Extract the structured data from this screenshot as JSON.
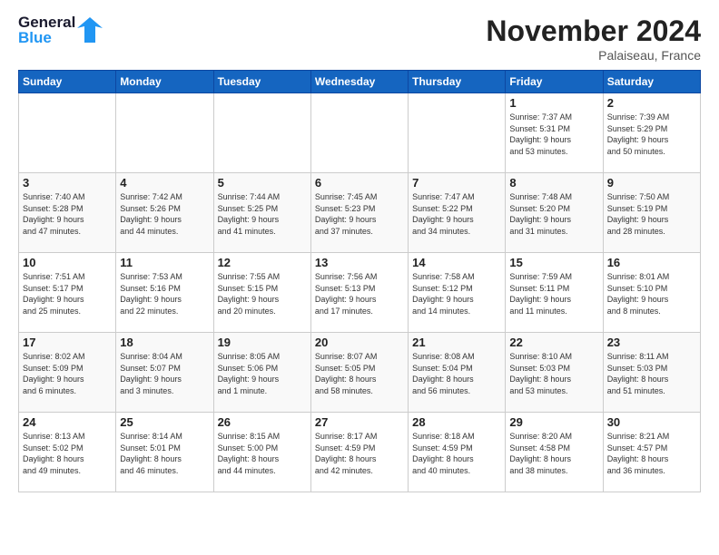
{
  "logo": {
    "line1": "General",
    "line2": "Blue"
  },
  "header": {
    "month": "November 2024",
    "location": "Palaiseau, France"
  },
  "weekdays": [
    "Sunday",
    "Monday",
    "Tuesday",
    "Wednesday",
    "Thursday",
    "Friday",
    "Saturday"
  ],
  "weeks": [
    [
      {
        "day": "",
        "info": ""
      },
      {
        "day": "",
        "info": ""
      },
      {
        "day": "",
        "info": ""
      },
      {
        "day": "",
        "info": ""
      },
      {
        "day": "",
        "info": ""
      },
      {
        "day": "1",
        "info": "Sunrise: 7:37 AM\nSunset: 5:31 PM\nDaylight: 9 hours\nand 53 minutes."
      },
      {
        "day": "2",
        "info": "Sunrise: 7:39 AM\nSunset: 5:29 PM\nDaylight: 9 hours\nand 50 minutes."
      }
    ],
    [
      {
        "day": "3",
        "info": "Sunrise: 7:40 AM\nSunset: 5:28 PM\nDaylight: 9 hours\nand 47 minutes."
      },
      {
        "day": "4",
        "info": "Sunrise: 7:42 AM\nSunset: 5:26 PM\nDaylight: 9 hours\nand 44 minutes."
      },
      {
        "day": "5",
        "info": "Sunrise: 7:44 AM\nSunset: 5:25 PM\nDaylight: 9 hours\nand 41 minutes."
      },
      {
        "day": "6",
        "info": "Sunrise: 7:45 AM\nSunset: 5:23 PM\nDaylight: 9 hours\nand 37 minutes."
      },
      {
        "day": "7",
        "info": "Sunrise: 7:47 AM\nSunset: 5:22 PM\nDaylight: 9 hours\nand 34 minutes."
      },
      {
        "day": "8",
        "info": "Sunrise: 7:48 AM\nSunset: 5:20 PM\nDaylight: 9 hours\nand 31 minutes."
      },
      {
        "day": "9",
        "info": "Sunrise: 7:50 AM\nSunset: 5:19 PM\nDaylight: 9 hours\nand 28 minutes."
      }
    ],
    [
      {
        "day": "10",
        "info": "Sunrise: 7:51 AM\nSunset: 5:17 PM\nDaylight: 9 hours\nand 25 minutes."
      },
      {
        "day": "11",
        "info": "Sunrise: 7:53 AM\nSunset: 5:16 PM\nDaylight: 9 hours\nand 22 minutes."
      },
      {
        "day": "12",
        "info": "Sunrise: 7:55 AM\nSunset: 5:15 PM\nDaylight: 9 hours\nand 20 minutes."
      },
      {
        "day": "13",
        "info": "Sunrise: 7:56 AM\nSunset: 5:13 PM\nDaylight: 9 hours\nand 17 minutes."
      },
      {
        "day": "14",
        "info": "Sunrise: 7:58 AM\nSunset: 5:12 PM\nDaylight: 9 hours\nand 14 minutes."
      },
      {
        "day": "15",
        "info": "Sunrise: 7:59 AM\nSunset: 5:11 PM\nDaylight: 9 hours\nand 11 minutes."
      },
      {
        "day": "16",
        "info": "Sunrise: 8:01 AM\nSunset: 5:10 PM\nDaylight: 9 hours\nand 8 minutes."
      }
    ],
    [
      {
        "day": "17",
        "info": "Sunrise: 8:02 AM\nSunset: 5:09 PM\nDaylight: 9 hours\nand 6 minutes."
      },
      {
        "day": "18",
        "info": "Sunrise: 8:04 AM\nSunset: 5:07 PM\nDaylight: 9 hours\nand 3 minutes."
      },
      {
        "day": "19",
        "info": "Sunrise: 8:05 AM\nSunset: 5:06 PM\nDaylight: 9 hours\nand 1 minute."
      },
      {
        "day": "20",
        "info": "Sunrise: 8:07 AM\nSunset: 5:05 PM\nDaylight: 8 hours\nand 58 minutes."
      },
      {
        "day": "21",
        "info": "Sunrise: 8:08 AM\nSunset: 5:04 PM\nDaylight: 8 hours\nand 56 minutes."
      },
      {
        "day": "22",
        "info": "Sunrise: 8:10 AM\nSunset: 5:03 PM\nDaylight: 8 hours\nand 53 minutes."
      },
      {
        "day": "23",
        "info": "Sunrise: 8:11 AM\nSunset: 5:03 PM\nDaylight: 8 hours\nand 51 minutes."
      }
    ],
    [
      {
        "day": "24",
        "info": "Sunrise: 8:13 AM\nSunset: 5:02 PM\nDaylight: 8 hours\nand 49 minutes."
      },
      {
        "day": "25",
        "info": "Sunrise: 8:14 AM\nSunset: 5:01 PM\nDaylight: 8 hours\nand 46 minutes."
      },
      {
        "day": "26",
        "info": "Sunrise: 8:15 AM\nSunset: 5:00 PM\nDaylight: 8 hours\nand 44 minutes."
      },
      {
        "day": "27",
        "info": "Sunrise: 8:17 AM\nSunset: 4:59 PM\nDaylight: 8 hours\nand 42 minutes."
      },
      {
        "day": "28",
        "info": "Sunrise: 8:18 AM\nSunset: 4:59 PM\nDaylight: 8 hours\nand 40 minutes."
      },
      {
        "day": "29",
        "info": "Sunrise: 8:20 AM\nSunset: 4:58 PM\nDaylight: 8 hours\nand 38 minutes."
      },
      {
        "day": "30",
        "info": "Sunrise: 8:21 AM\nSunset: 4:57 PM\nDaylight: 8 hours\nand 36 minutes."
      }
    ]
  ]
}
